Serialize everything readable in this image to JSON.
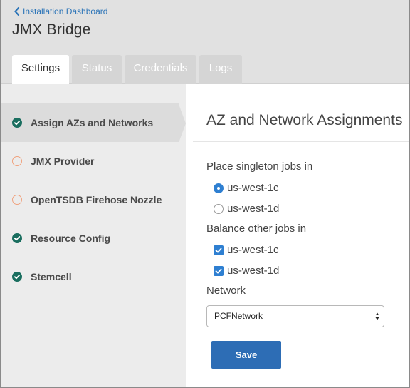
{
  "header": {
    "back_link": "Installation Dashboard",
    "title": "JMX Bridge"
  },
  "tabs": [
    {
      "label": "Settings",
      "active": true
    },
    {
      "label": "Status",
      "active": false
    },
    {
      "label": "Credentials",
      "active": false
    },
    {
      "label": "Logs",
      "active": false
    }
  ],
  "sidebar": {
    "items": [
      {
        "label": "Assign AZs and Networks",
        "state": "complete",
        "active": true
      },
      {
        "label": "JMX Provider",
        "state": "incomplete",
        "active": false
      },
      {
        "label": "OpenTSDB Firehose Nozzle",
        "state": "incomplete",
        "active": false
      },
      {
        "label": "Resource Config",
        "state": "complete",
        "active": false
      },
      {
        "label": "Stemcell",
        "state": "complete",
        "active": false
      }
    ]
  },
  "main": {
    "section_title": "AZ and Network Assignments",
    "singleton_label": "Place singleton jobs in",
    "singleton_options": [
      {
        "label": "us-west-1c",
        "checked": true
      },
      {
        "label": "us-west-1d",
        "checked": false
      }
    ],
    "balance_label": "Balance other jobs in",
    "balance_options": [
      {
        "label": "us-west-1c",
        "checked": true
      },
      {
        "label": "us-west-1d",
        "checked": true
      }
    ],
    "network_label": "Network",
    "network_selected": "PCFNetwork",
    "save_label": "Save"
  },
  "colors": {
    "link": "#2d75b8",
    "complete": "#1a6e5f",
    "incomplete": "#f0a27e",
    "accent": "#2e7fd1",
    "button": "#2d6db5"
  }
}
